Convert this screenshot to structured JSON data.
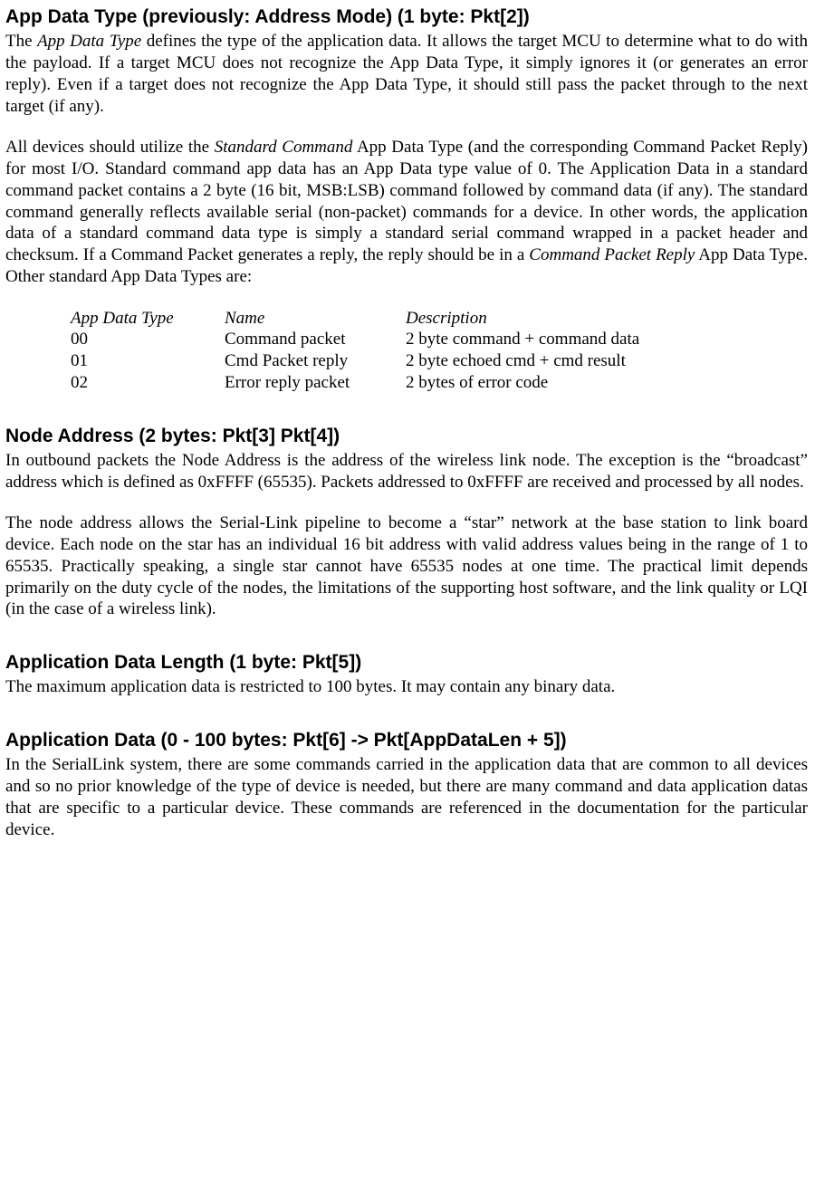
{
  "section1": {
    "heading": "App Data Type (previously: Address Mode) (1 byte: Pkt[2])",
    "p1_a": "The ",
    "p1_b": "App Data Type",
    "p1_c": " defines the type of the application data.   It allows the target MCU to determine what to do with the payload.  If a target MCU does not recognize the App Data Type, it simply ignores it (or generates an error reply).    Even if a target does not recognize the App Data Type, it should still pass the packet through to the next target (if any).",
    "p2_a": "All devices should utilize the ",
    "p2_b": "Standard Command",
    "p2_c": " App Data Type (and the corresponding Command Packet Reply) for most I/O.  Standard command app data has an App Data type value of 0.  The Application Data in a standard command packet contains a 2 byte (16 bit, MSB:LSB) command followed by command data (if any).  The standard command generally reflects available serial (non-packet) commands for a device.  In other words, the application data of a standard command data type is simply a standard serial command wrapped in a packet header and checksum.    If a Command Packet generates a reply, the reply should be in a ",
    "p2_d": "Command Packet Reply",
    "p2_e": " App Data Type.  Other standard App Data Types are:",
    "table": {
      "h1": "App Data Type",
      "h2": "Name",
      "h3": "Description",
      "rows": [
        {
          "c1": "00",
          "c2": "Command packet",
          "c3": "2 byte command + command data"
        },
        {
          "c1": "01",
          "c2": "Cmd Packet reply",
          "c3": "2 byte echoed cmd + cmd result"
        },
        {
          "c1": "02",
          "c2": "Error reply packet",
          "c3": "2 bytes of error code"
        }
      ]
    }
  },
  "section2": {
    "heading": "Node Address (2 bytes: Pkt[3] Pkt[4])",
    "p1": "In outbound packets the Node Address is the address of the wireless link node.  The exception is the “broadcast” address which is defined as 0xFFFF (65535).  Packets addressed to 0xFFFF are received and processed by all nodes.",
    "p2": "The node address allows the Serial-Link pipeline to become a “star” network at the base station to link board device.  Each node on the star has an individual 16 bit address with valid address values being in the range of 1 to 65535.  Practically speaking, a single star cannot have 65535 nodes at one time.  The practical limit depends primarily on the duty cycle of the nodes, the limitations of the supporting host software, and the link quality or LQI (in the case of a wireless link)."
  },
  "section3": {
    "heading": "Application Data Length (1 byte: Pkt[5])",
    "p1": "The maximum application data is restricted to 100 bytes.  It may contain any binary data."
  },
  "section4": {
    "heading": "Application Data (0 - 100 bytes: Pkt[6] -> Pkt[AppDataLen + 5])",
    "p1": "In the SerialLink system, there are some commands carried in the application data that are common to all devices and so no prior knowledge of the type of device is needed, but there are many command and data application datas that are specific to a particular device.  These commands are referenced in the documentation for the particular device."
  }
}
